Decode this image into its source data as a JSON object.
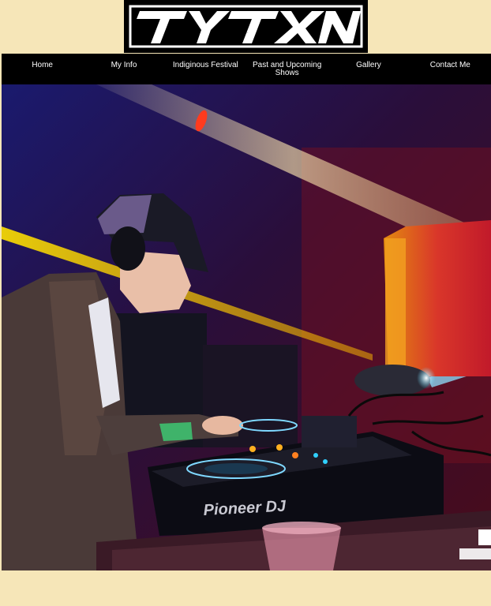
{
  "logo": {
    "text": "TYTXN"
  },
  "nav": {
    "items": [
      {
        "label": "Home"
      },
      {
        "label": "My Info"
      },
      {
        "label": "Indiginous Festival"
      },
      {
        "label": "Past and Upcoming Shows"
      },
      {
        "label": "Gallery"
      },
      {
        "label": "Contact Me"
      }
    ]
  },
  "hero": {
    "deck_brand": "Pioneer DJ",
    "description": "DJ performing on Pioneer DJ decks"
  },
  "colors": {
    "page_bg": "#f6e6b8",
    "nav_bg": "#000000",
    "nav_text": "#ffffff"
  }
}
